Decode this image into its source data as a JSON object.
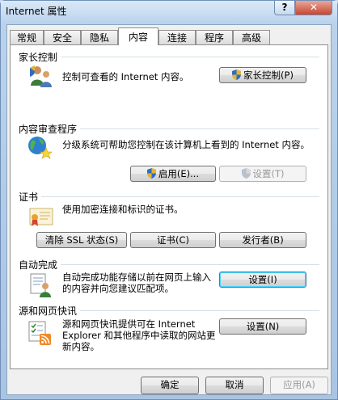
{
  "window": {
    "title": "Internet 属性"
  },
  "caption_buttons": {
    "help": "?",
    "close": "✕"
  },
  "tabs": [
    {
      "label": "常规"
    },
    {
      "label": "安全"
    },
    {
      "label": "隐私"
    },
    {
      "label": "内容",
      "active": true
    },
    {
      "label": "连接"
    },
    {
      "label": "程序"
    },
    {
      "label": "高级"
    }
  ],
  "parental": {
    "title": "家长控制",
    "description": "控制可查看的 Internet 内容。",
    "button": "家长控制(P)"
  },
  "advisor": {
    "title": "内容审查程序",
    "description": "分级系统可帮助您控制在该计算机上看到的 Internet 内容。",
    "enable_button": "启用(E)...",
    "settings_button": "设置(T)"
  },
  "certificates": {
    "title": "证书",
    "description": "使用加密连接和标识的证书。",
    "clear_ssl_button": "清除 SSL 状态(S)",
    "certificates_button": "证书(C)",
    "publishers_button": "发行者(B)"
  },
  "autocomplete": {
    "title": "自动完成",
    "description": "自动完成功能存储以前在网页上输入的内容并向您建议匹配项。",
    "settings_button": "设置(I)"
  },
  "feeds": {
    "title": "源和网页快讯",
    "description": "源和网页快讯提供可在 Internet Explorer 和其他程序中读取的网站更新内容。",
    "settings_button": "设置(N)"
  },
  "footer": {
    "ok": "确定",
    "cancel": "取消",
    "apply": "应用(A)"
  },
  "colors": {
    "accent": "#3c7fb1",
    "disabled_text": "#9a9a9a"
  }
}
